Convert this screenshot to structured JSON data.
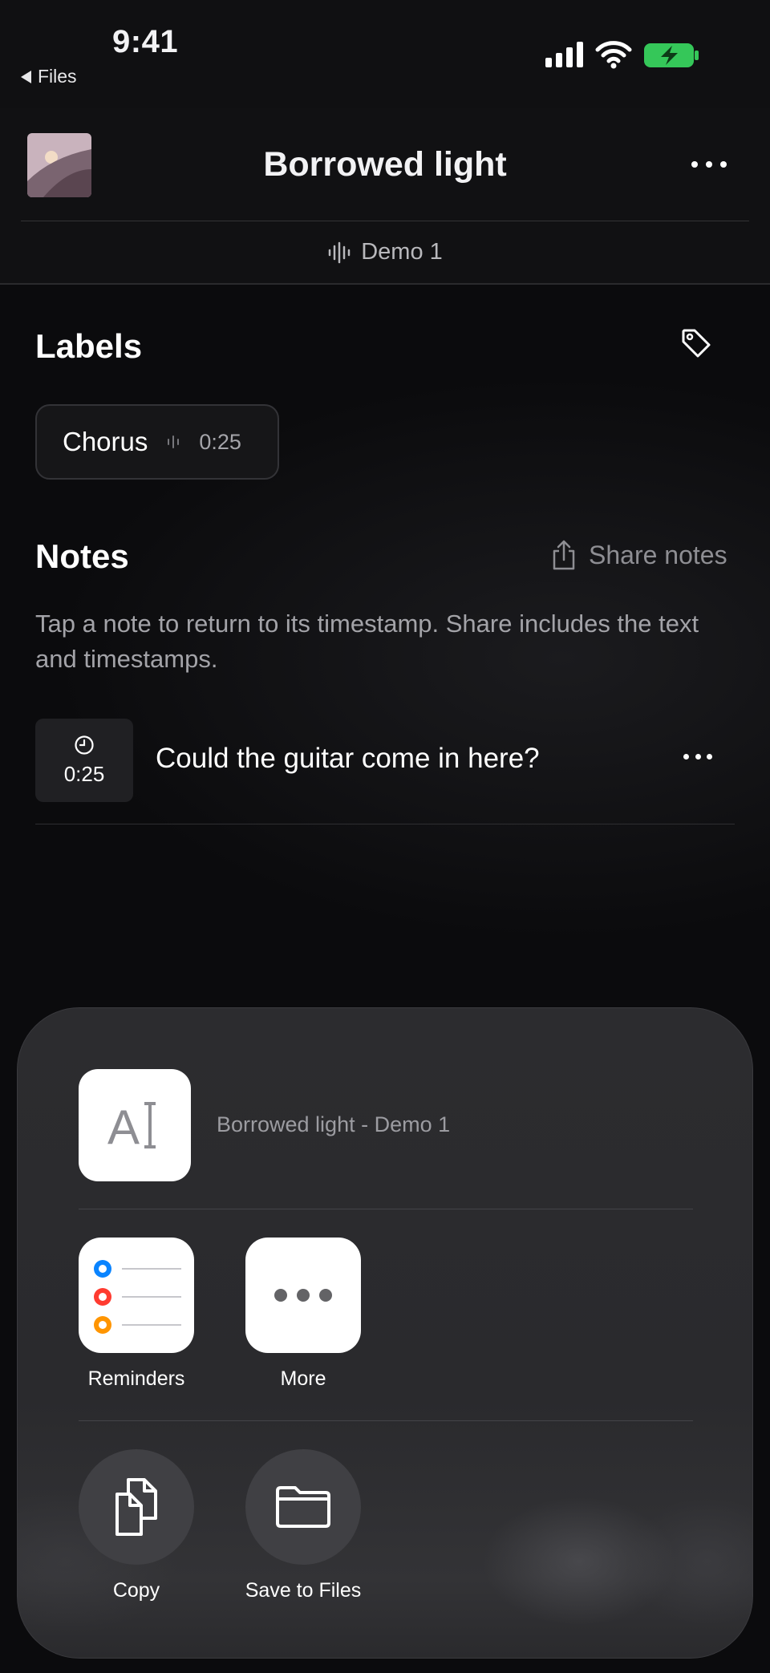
{
  "status_bar": {
    "time": "9:41",
    "back_app": "Files"
  },
  "header": {
    "title": "Borrowed light",
    "version": "Demo 1"
  },
  "labels": {
    "title": "Labels",
    "chips": [
      {
        "label": "Chorus",
        "time": "0:25"
      }
    ]
  },
  "notes": {
    "title": "Notes",
    "share_label": "Share notes",
    "hint": "Tap a note to return to its timestamp. Share includes the text and timestamps.",
    "items": [
      {
        "time": "0:25",
        "text": "Could the guitar come in here?"
      }
    ]
  },
  "share_sheet": {
    "doc_title": "Borrowed light - Demo 1",
    "apps": [
      {
        "label": "Reminders",
        "icon": "reminders-icon"
      },
      {
        "label": "More",
        "icon": "more-icon"
      }
    ],
    "actions": [
      {
        "label": "Copy",
        "icon": "copy-icon"
      },
      {
        "label": "Save to Files",
        "icon": "folder-icon"
      }
    ]
  },
  "colors": {
    "battery_green": "#35c759",
    "background": "#0b0b0d",
    "sheet": "#2a2a2d"
  }
}
